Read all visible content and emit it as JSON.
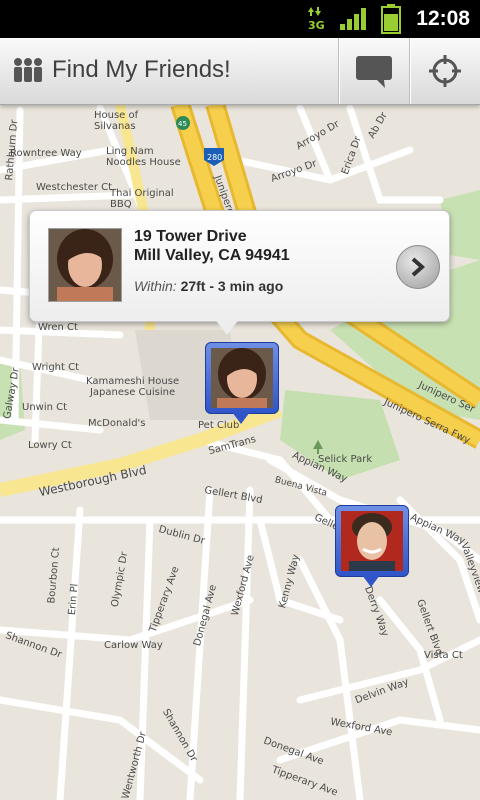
{
  "status_bar": {
    "time": "12:08",
    "network": "3G"
  },
  "app_bar": {
    "title": "Find My Friends!",
    "icons": [
      "people-icon",
      "chat-icon",
      "my-location-icon"
    ]
  },
  "popup": {
    "address_line1": "19 Tower Drive",
    "address_line2": "Mill Valley, CA 94941",
    "within_label": "Within:",
    "within_value": "27ft - 3 min ago"
  },
  "map": {
    "labels": {
      "house_of_silvanas": "House of\nSilvanas",
      "rowntree_way": "Rowntree Way",
      "ling_nam": "Ling Nam\nNoodles House",
      "westchester_ct": "Westchester Ct",
      "thai_original_bbq": "Thai Original\nBBQ",
      "rathburn_dr": "Rathburn Dr",
      "junipero": "Junipero",
      "arroyo_dr1": "Arroyo Dr",
      "arroyo_dr2": "Arroyo Dr",
      "erica_dr": "Erica Dr",
      "ab_dr": "Ab Dr",
      "wren_ct": "Wren Ct",
      "wright_ct": "Wright Ct",
      "galway_dr": "Galway Dr",
      "unwin_ct": "Unwin Ct",
      "lowry_ct": "Lowry Ct",
      "kamameshi": "Kamameshi House\nJapanese Cuisine",
      "mcdonalds": "McDonald's",
      "pet_club": "Pet Club",
      "samtrans": "SamTrans",
      "junipero_serra1": "Junipero Ser",
      "junipero_serra2": "Junipero Serra Fwy",
      "selick_park": "Selick Park",
      "appian_way1": "Appian Way",
      "appian_way2": "Appian Way",
      "westborough_blvd": "Westborough Blvd",
      "gellert_blvd1": "Gellert Blvd",
      "gellert_blvd2": "Gellert Blvd",
      "buena_vista": "Buena Vista",
      "dublin_dr": "Dublin Dr",
      "bourbon_ct": "Bourbon Ct",
      "olympic_dr": "Olympic Dr",
      "tipperary_ave1": "Tipperary Ave",
      "donegal_ave": "Donegal Ave",
      "wexford_ave": "Wexford Ave",
      "kenny_way": "Kenny Way",
      "derry_way": "Derry Way",
      "gellert_blvd3": "Gellert Blvd",
      "erin_pl": "Erin Pl",
      "carlow_way": "Carlow Way",
      "shannon_dr1": "Shannon Dr",
      "shannon_dr2": "Shannon Dr",
      "delvin_way": "Delvin Way",
      "vista_ct": "Vista Ct",
      "wexford_ave2": "Wexford Ave",
      "donegal_ave2": "Donegal Ave",
      "tipperary_ave2": "Tipperary Ave",
      "wentworth_dr": "Wentworth Dr",
      "valleyview_way": "Valleyview Way",
      "hwy_280": "280",
      "hwy_45": "45"
    }
  },
  "colors": {
    "status_bar": "#000000",
    "map_bg": "#e9e5dc",
    "freeway": "#f6d04d",
    "pin": "#3a60cf"
  }
}
